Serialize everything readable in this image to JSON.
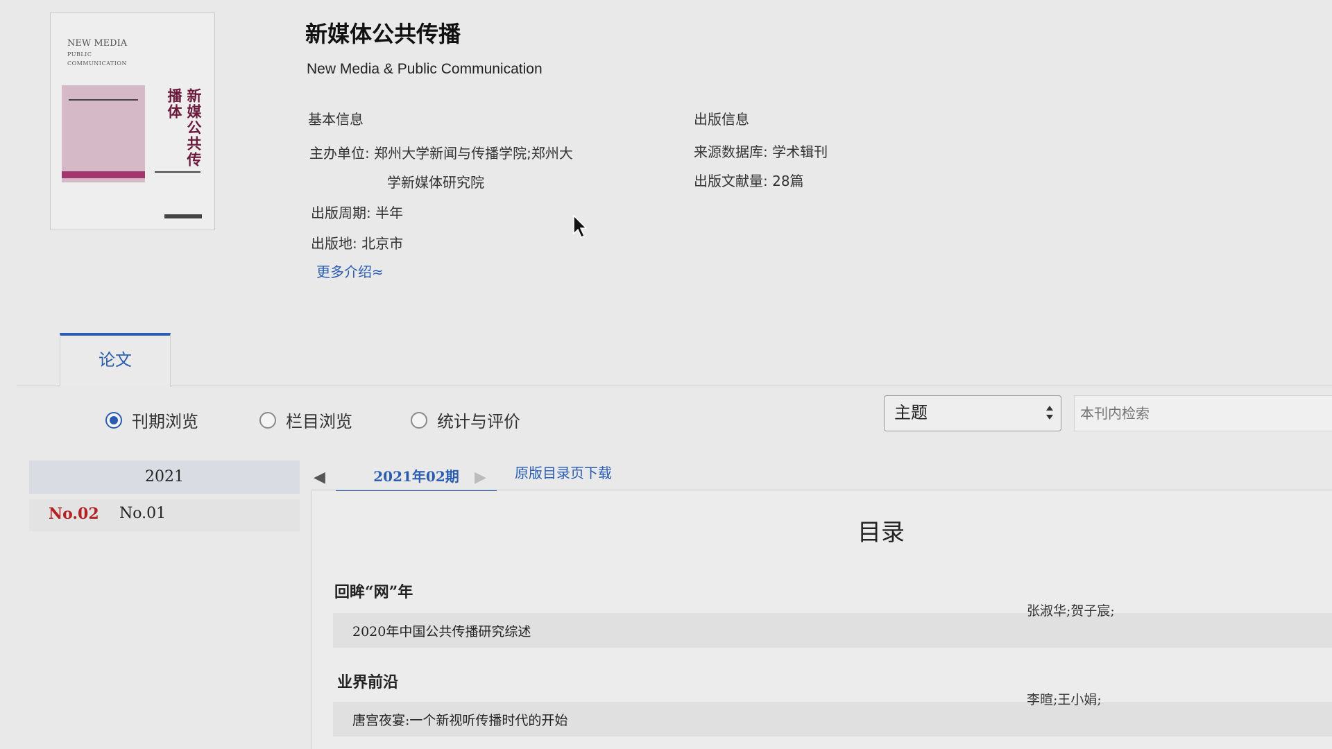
{
  "journal": {
    "title_cn": "新媒体公共传播",
    "title_en": "New Media & Public Communication",
    "cover": {
      "en_line1": "NEW MEDIA",
      "en_line2": "PUBLIC",
      "en_line3": "COMMUNICATION",
      "cn_title": "新媒公共传播体"
    }
  },
  "basic_info": {
    "heading": "基本信息",
    "sponsor_label": "主办单位:",
    "sponsor_line1": "郑州大学新闻与传播学院;郑州大",
    "sponsor_line2": "学新媒体研究院",
    "cycle_label": "出版周期:",
    "cycle_value": "半年",
    "place_label": "出版地:",
    "place_value": "北京市",
    "more_link": "更多介绍≈"
  },
  "publish_info": {
    "heading": "出版信息",
    "source_label": "来源数据库:",
    "source_value": "学术辑刊",
    "count_label": "出版文献量:",
    "count_value": "28篇"
  },
  "tabs": {
    "paper": "论文"
  },
  "browse_modes": {
    "issue": "刊期浏览",
    "column": "栏目浏览",
    "stats": "统计与评价",
    "selected": "issue"
  },
  "search": {
    "field_selected": "主题",
    "placeholder": "本刊内检索"
  },
  "years": {
    "year": "2021",
    "issues": [
      "No.02",
      "No.01"
    ],
    "active_issue": "No.02"
  },
  "issue_nav": {
    "current": "2021年02期",
    "download": "原版目录页下载"
  },
  "toc": {
    "title": "目录",
    "sections": [
      {
        "name": "回眸“网”年",
        "articles": [
          {
            "title": "2020年中国公共传播研究综述",
            "authors": "张淑华;贺子宸;"
          }
        ]
      },
      {
        "name": "业界前沿",
        "articles": [
          {
            "title": "唐宫夜宴:一个新视听传播时代的开始",
            "authors": "李暄;王小娟;"
          }
        ]
      }
    ]
  },
  "colors": {
    "accent": "#2a5cb0",
    "active_issue": "#b22222",
    "cover_accent": "#a3366f"
  }
}
